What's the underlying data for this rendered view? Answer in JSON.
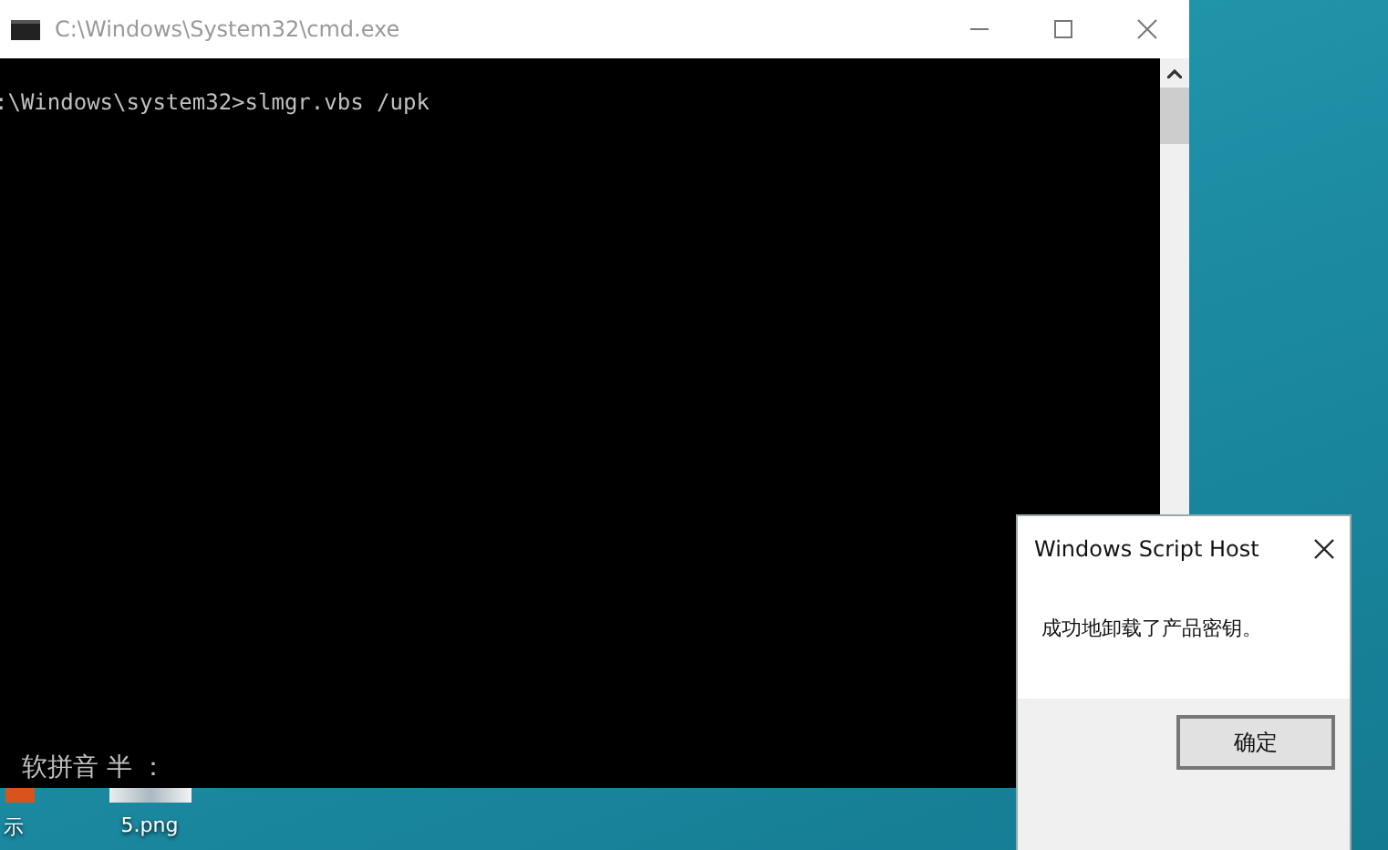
{
  "console_window": {
    "title": "C:\\Windows\\System32\\cmd.exe",
    "lines": [
      ":\\Windows\\system32>slmgr.vbs /upk"
    ],
    "ime_status": "软拼音 半 ："
  },
  "desktop_icons": [
    {
      "kind": "orange",
      "label": "示"
    },
    {
      "kind": "thumbnail",
      "label": "5.png"
    }
  ],
  "dialog": {
    "title": "Windows Script Host",
    "message": "成功地卸载了产品密钥。",
    "buttons": [
      "确定"
    ]
  }
}
